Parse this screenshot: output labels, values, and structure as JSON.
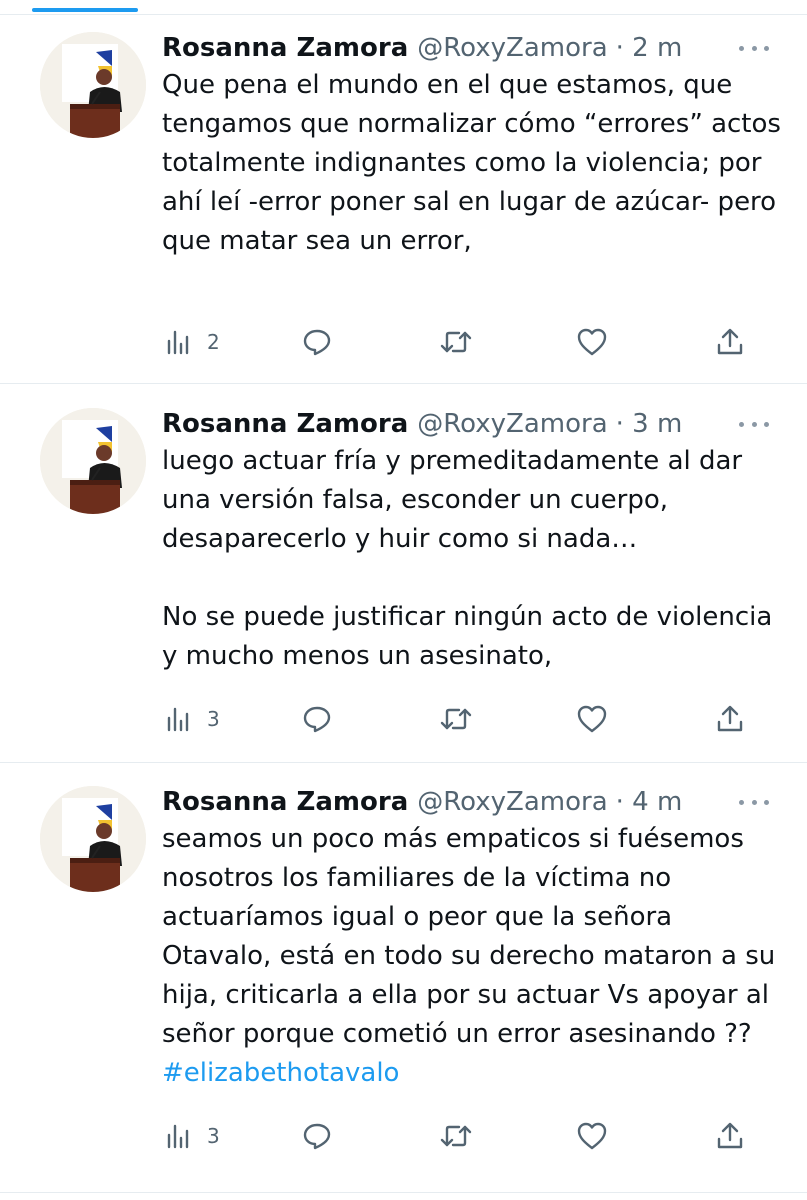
{
  "feed": {
    "tweets": [
      {
        "author_name": "Rosanna Zamora",
        "handle": "@RoxyZamora",
        "time": "· 2 m",
        "text": "Que pena el mundo en el que estamos, que tengamos que normalizar cómo “errores” actos totalmente indignantes como la violencia; por ahí leí -error poner sal en lugar de azúcar- pero que matar sea un error,",
        "hashtag": "",
        "views": "2"
      },
      {
        "author_name": "Rosanna Zamora",
        "handle": "@RoxyZamora",
        "time": "· 3 m",
        "text": "luego actuar fría y premeditadamente al dar una versión falsa, esconder un cuerpo, desaparecerlo y huir como si nada…\n\nNo se puede justificar ningún acto de violencia y mucho menos un asesinato,",
        "hashtag": "",
        "views": "3"
      },
      {
        "author_name": "Rosanna Zamora",
        "handle": "@RoxyZamora",
        "time": "· 4 m",
        "text": "seamos un poco más empaticos si fuésemos nosotros los familiares de la víctima no actuaríamos igual o peor que la señora Otavalo, está en todo su derecho mataron a su hija, criticarla a ella por su actuar Vs apoyar al señor porque cometió un error asesinando ?? ",
        "hashtag": "#elizabethotavalo",
        "views": "3"
      }
    ]
  },
  "icons": {
    "views": "views-icon",
    "reply": "reply-icon",
    "retweet": "retweet-icon",
    "like": "like-icon",
    "share": "share-icon",
    "more": "more-icon"
  },
  "colors": {
    "accent": "#1d9bf0",
    "secondary_text": "#536471",
    "divider": "#e6ecf0"
  }
}
